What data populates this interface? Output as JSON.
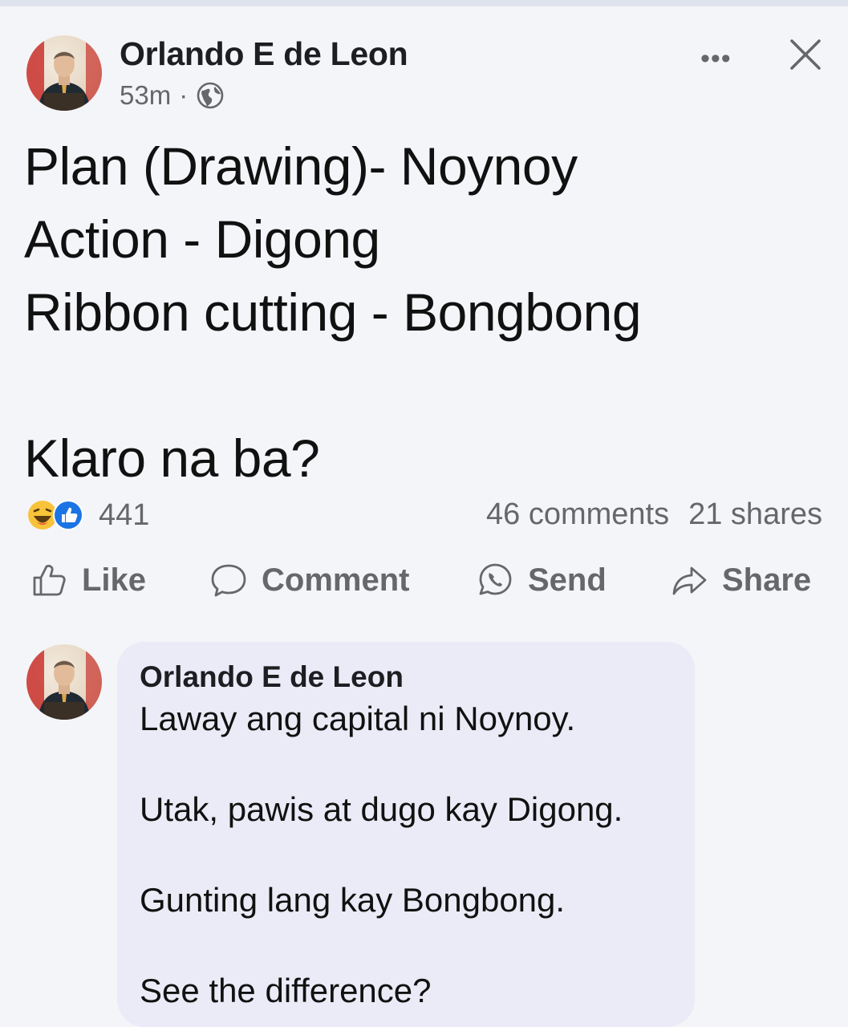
{
  "post": {
    "author": "Orlando E de Leon",
    "time": "53m",
    "separator": "·",
    "audience_icon": "globe-icon",
    "more_icon": "more-options-icon",
    "more_label": "•••",
    "close_icon": "close-icon",
    "text_lines": [
      "Plan (Drawing)- Noynoy",
      "Action - Digong",
      "Ribbon cutting - Bongbong",
      "",
      "Klaro na ba?"
    ]
  },
  "stats": {
    "reaction_icons": [
      "haha-reaction-icon",
      "like-reaction-icon"
    ],
    "reaction_count": "441",
    "comments": "46 comments",
    "shares": "21 shares"
  },
  "actions": {
    "like": "Like",
    "comment": "Comment",
    "send": "Send",
    "share": "Share"
  },
  "comment": {
    "author": "Orlando E de Leon",
    "lines": [
      "Laway ang capital ni Noynoy.",
      "Utak, pawis at dugo kay Digong.",
      "Gunting lang kay Bongbong.",
      "See the difference?"
    ]
  },
  "colors": {
    "background": "#f4f5f9",
    "comment_bubble": "#ebebf7",
    "secondary_text": "#65676b",
    "like_blue": "#1b74e4",
    "haha_yellow": "#f7c33a"
  }
}
